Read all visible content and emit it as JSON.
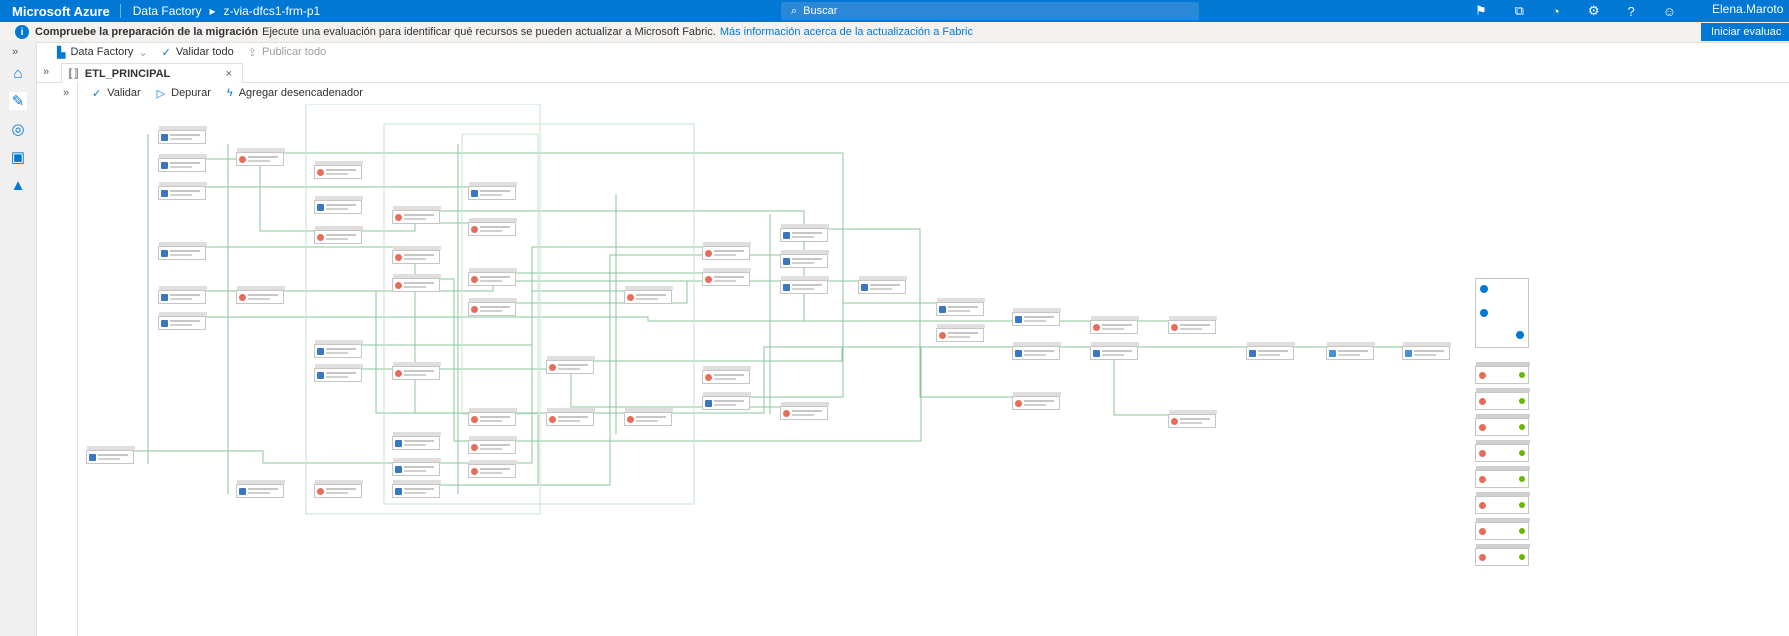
{
  "topbar": {
    "brand": "Microsoft Azure",
    "service": "Data Factory",
    "resource": "z-via-dfcs1-frm-p1",
    "search_placeholder": "Buscar",
    "user": "Elena.Maroto",
    "icons": [
      "feedback-icon",
      "directory-icon",
      "bell-icon",
      "settings-icon",
      "help-icon",
      "person-feedback-icon"
    ]
  },
  "banner": {
    "bold": "Compruebe la preparación de la migración",
    "text": "Ejecute una evaluación para identificar qué recursos se pueden actualizar a Microsoft Fabric.",
    "link": "Más información acerca de la actualización a Fabric",
    "button": "Iniciar evaluac"
  },
  "factory_toolbar": {
    "factory": "Data Factory",
    "validate_all": "Validar todo",
    "publish_all": "Publicar todo"
  },
  "tab": {
    "label": "ETL_PRINCIPAL",
    "close": "×"
  },
  "pipeline_toolbar": {
    "validate": "Validar",
    "debug": "Depurar",
    "add_trigger": "Agregar desencadenador"
  },
  "rail_icons": [
    "home-icon",
    "pencil-icon",
    "monitor-icon",
    "toolbox-icon",
    "graduation-cap-icon"
  ],
  "colors": {
    "azure_blue": "#0078d4",
    "connector_green": "#8bc49b",
    "dataflow_red": "#e86c5a",
    "copy_blue": "#3a77c1",
    "success_green": "#6bb700"
  }
}
